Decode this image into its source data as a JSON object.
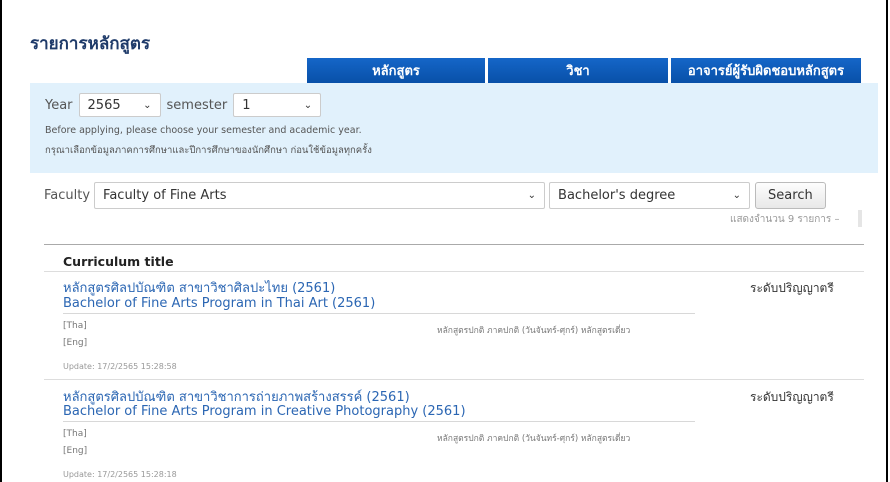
{
  "page": {
    "title": "รายการหลักสูตร"
  },
  "tabs": [
    {
      "label": "หลักสูตร"
    },
    {
      "label": "วิชา"
    },
    {
      "label": "อาจารย์ผู้รับผิดชอบหลักสูตร"
    }
  ],
  "filters": {
    "year_label": "Year",
    "year_value": "2565",
    "semester_label": "semester",
    "semester_value": "1",
    "note_en": "Before applying, please choose your semester and academic year.",
    "note_th": "กรุณาเลือกข้อมูลภาคการศึกษาและปีการศึกษาของนักศึกษา ก่อนใช้ข้อมูลทุกครั้ง",
    "faculty_label": "Faculty",
    "faculty_value": "Faculty of Fine Arts",
    "degree_value": "Bachelor's degree",
    "search_label": "Search",
    "result_count": "แสดงจำนวน 9 รายการ  –"
  },
  "table": {
    "header": "Curriculum title",
    "rows": [
      {
        "title_th": "หลักสูตรศิลปบัณฑิต สาขาวิชาศิลปะไทย (2561)",
        "title_en": "Bachelor of Fine Arts Program in Thai Art (2561)",
        "level": "ระดับปริญญาตรี",
        "lang_th": "[Tha]",
        "lang_en": "[Eng]",
        "tags": "หลักสูตรปกติ  ภาคปกติ (วันจันทร์-ศุกร์)  หลักสูตรเดี่ยว",
        "update": "Update: 17/2/2565 15:28:58"
      },
      {
        "title_th": "หลักสูตรศิลปบัณฑิต สาขาวิชาการถ่ายภาพสร้างสรรค์ (2561)",
        "title_en": "Bachelor of Fine Arts Program in Creative Photography (2561)",
        "level": "ระดับปริญญาตรี",
        "lang_th": "[Tha]",
        "lang_en": "[Eng]",
        "tags": "หลักสูตรปกติ  ภาคปกติ (วันจันทร์-ศุกร์)  หลักสูตรเดี่ยว",
        "update": "Update: 17/2/2565 15:28:18"
      }
    ]
  },
  "colors": {
    "tab_blue": "#0a56b0",
    "filter_bg": "#e1f1fc",
    "link_blue": "#2b66b3"
  }
}
